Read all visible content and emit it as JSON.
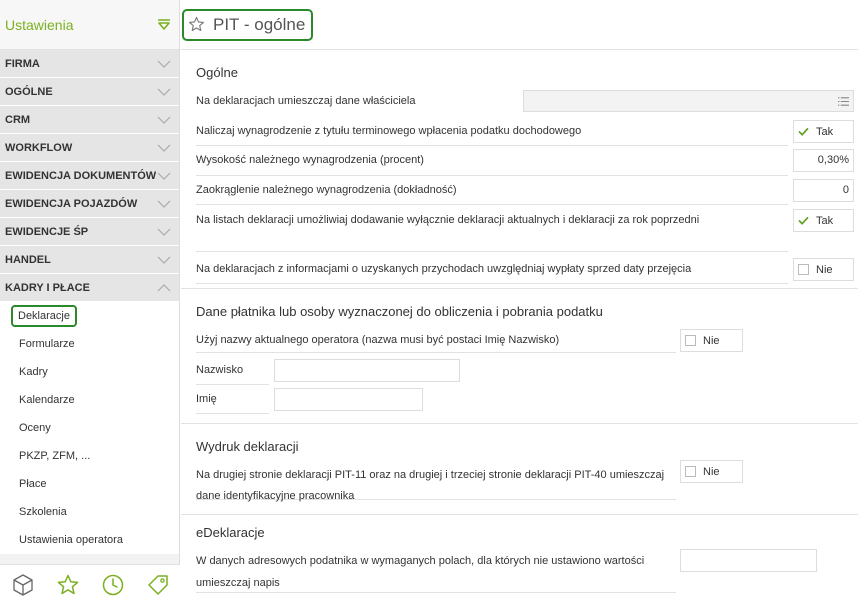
{
  "sidebar": {
    "title": "Ustawienia",
    "sections": [
      "FIRMA",
      "OGÓLNE",
      "CRM",
      "WORKFLOW",
      "EWIDENCJA DOKUMENTÓW",
      "EWIDENCJA POJAZDÓW",
      "EWIDENCJE ŚP",
      "HANDEL",
      "KADRY I PŁACE"
    ],
    "subitems": [
      "Deklaracje",
      "Formularze",
      "Kadry",
      "Kalendarze",
      "Oceny",
      "PKZP, ZFM, ...",
      "Płace",
      "Szkolenia",
      "Ustawienia operatora"
    ],
    "active_subitem": "Deklaracje"
  },
  "header": {
    "title": "PIT - ogólne"
  },
  "ogolne": {
    "title": "Ogólne",
    "owner_label": "Na deklaracjach umieszczaj dane właściciela",
    "naliczaj_label": "Naliczaj wynagrodzenie z tytułu terminowego wpłacenia podatku dochodowego",
    "naliczaj_value": "Tak",
    "wysokosc_label": "Wysokość należnego wynagrodzenia (procent)",
    "wysokosc_value": "0,30%",
    "zaokraglenie_label": "Zaokrąglenie należnego wynagrodzenia (dokładność)",
    "zaokraglenie_value": "0",
    "listy_label": "Na listach deklaracji umożliwiaj dodawanie wyłącznie deklaracji aktualnych i deklaracji za rok poprzedni",
    "listy_value": "Tak",
    "informacje_label": "Na deklaracjach z informacjami o uzyskanych przychodach uwzględniaj wypłaty sprzed daty przejęcia",
    "informacje_value": "Nie"
  },
  "platnik": {
    "title": "Dane płatnika lub osoby wyznaczonej do obliczenia i pobrania podatku",
    "operator_label": "Użyj nazwy aktualnego operatora (nazwa musi być postaci Imię Nazwisko)",
    "operator_value": "Nie",
    "nazwisko_label": "Nazwisko",
    "imie_label": "Imię"
  },
  "wydruk": {
    "title": "Wydruk deklaracji",
    "label_line1": "Na drugiej stronie deklaracji PIT-11 oraz na drugiej i trzeciej stronie deklaracji PIT-40 umieszczaj",
    "label_line2": "dane identyfikacyjne pracownika",
    "value": "Nie"
  },
  "edeklaracje": {
    "title": "eDeklaracje",
    "label_line1": "W danych adresowych podatnika w wymaganych polach, dla których nie ustawiono wartości",
    "label_line2": "umieszczaj napis"
  },
  "colors": {
    "accent": "#7ab020",
    "highlight_border": "#2a8a2a",
    "check": "#5a9e1c"
  },
  "footer_icons": [
    "box-icon",
    "star-icon",
    "clock-icon",
    "tag-icon"
  ]
}
